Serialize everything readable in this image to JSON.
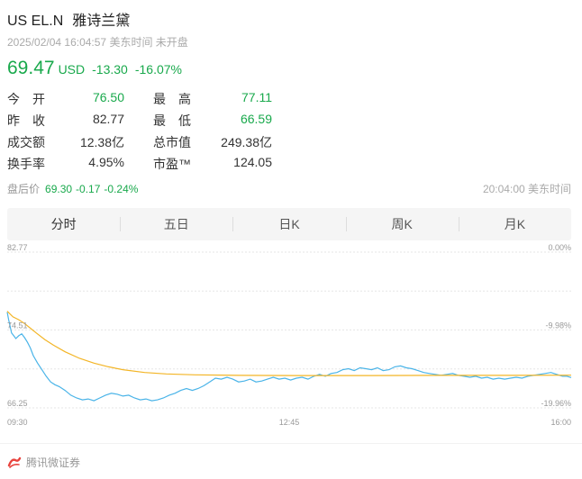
{
  "header": {
    "symbol": "US EL.N",
    "name": "雅诗兰黛",
    "timestamp": "2025/02/04 16:04:57 美东时间 未开盘"
  },
  "quote": {
    "price": "69.47",
    "currency": "USD",
    "change": "-13.30",
    "change_pct": "-16.07%",
    "color_down": "#19a94c"
  },
  "stats": [
    {
      "label": "今开",
      "value": "76.50",
      "label2": "最高",
      "value2": "77.11"
    },
    {
      "label": "昨收",
      "value": "82.77",
      "label2": "最低",
      "value2": "66.59"
    },
    {
      "label": "成交额",
      "value": "12.38亿",
      "label2": "总市值",
      "value2": "249.38亿"
    },
    {
      "label": "换手率",
      "value": "4.95%",
      "label2": "市盈™",
      "value2": "124.05"
    }
  ],
  "after_hours": {
    "label": "盘后价",
    "price": "69.30",
    "change": "-0.17",
    "change_pct": "-0.24%",
    "time": "20:04:00 美东时间"
  },
  "tabs": [
    "分时",
    "五日",
    "日K",
    "周K",
    "月K"
  ],
  "active_tab": 0,
  "chart_data": {
    "type": "line",
    "y_left_ticks": [
      "82.77",
      "74.51",
      "66.25"
    ],
    "y_right_ticks": [
      "0.00%",
      "-9.98%",
      "-19.96%"
    ],
    "x_ticks": [
      "09:30",
      "12:45",
      "16:00"
    ],
    "ylim": [
      66.25,
      82.77
    ],
    "grid": true,
    "series": [
      {
        "role": "price",
        "color": "#4ab4e8",
        "points": [
          [
            0,
            76.4
          ],
          [
            1,
            75.6
          ],
          [
            2,
            74.9
          ],
          [
            3,
            74.2
          ],
          [
            4,
            74.0
          ],
          [
            6,
            73.6
          ],
          [
            8,
            73.9
          ],
          [
            10,
            74.1
          ],
          [
            12,
            73.7
          ],
          [
            14,
            73.2
          ],
          [
            16,
            72.6
          ],
          [
            18,
            71.8
          ],
          [
            21,
            71.0
          ],
          [
            24,
            70.3
          ],
          [
            27,
            69.6
          ],
          [
            30,
            69.0
          ],
          [
            33,
            68.7
          ],
          [
            36,
            68.5
          ],
          [
            40,
            68.1
          ],
          [
            44,
            67.6
          ],
          [
            48,
            67.3
          ],
          [
            52,
            67.1
          ],
          [
            56,
            67.2
          ],
          [
            60,
            67.0
          ],
          [
            64,
            67.3
          ],
          [
            68,
            67.6
          ],
          [
            72,
            67.8
          ],
          [
            76,
            67.7
          ],
          [
            80,
            67.5
          ],
          [
            84,
            67.6
          ],
          [
            88,
            67.3
          ],
          [
            92,
            67.1
          ],
          [
            96,
            67.2
          ],
          [
            100,
            67.0
          ],
          [
            104,
            67.1
          ],
          [
            108,
            67.3
          ],
          [
            112,
            67.6
          ],
          [
            116,
            67.8
          ],
          [
            120,
            68.1
          ],
          [
            124,
            68.3
          ],
          [
            128,
            68.1
          ],
          [
            132,
            68.3
          ],
          [
            136,
            68.6
          ],
          [
            140,
            69.0
          ],
          [
            144,
            69.4
          ],
          [
            148,
            69.3
          ],
          [
            152,
            69.5
          ],
          [
            156,
            69.3
          ],
          [
            160,
            69.0
          ],
          [
            164,
            69.1
          ],
          [
            168,
            69.3
          ],
          [
            172,
            69.0
          ],
          [
            176,
            69.1
          ],
          [
            180,
            69.3
          ],
          [
            184,
            69.5
          ],
          [
            188,
            69.3
          ],
          [
            192,
            69.4
          ],
          [
            196,
            69.2
          ],
          [
            200,
            69.4
          ],
          [
            204,
            69.5
          ],
          [
            208,
            69.3
          ],
          [
            212,
            69.6
          ],
          [
            216,
            69.8
          ],
          [
            220,
            69.6
          ],
          [
            224,
            69.9
          ],
          [
            228,
            70.0
          ],
          [
            232,
            70.3
          ],
          [
            236,
            70.4
          ],
          [
            240,
            70.2
          ],
          [
            244,
            70.5
          ],
          [
            248,
            70.4
          ],
          [
            252,
            70.3
          ],
          [
            256,
            70.5
          ],
          [
            260,
            70.2
          ],
          [
            264,
            70.3
          ],
          [
            268,
            70.6
          ],
          [
            272,
            70.7
          ],
          [
            276,
            70.5
          ],
          [
            280,
            70.4
          ],
          [
            284,
            70.2
          ],
          [
            288,
            70.0
          ],
          [
            292,
            69.9
          ],
          [
            296,
            69.8
          ],
          [
            300,
            69.7
          ],
          [
            304,
            69.8
          ],
          [
            308,
            69.9
          ],
          [
            312,
            69.7
          ],
          [
            316,
            69.6
          ],
          [
            320,
            69.5
          ],
          [
            324,
            69.6
          ],
          [
            328,
            69.4
          ],
          [
            332,
            69.5
          ],
          [
            336,
            69.3
          ],
          [
            340,
            69.4
          ],
          [
            344,
            69.3
          ],
          [
            348,
            69.4
          ],
          [
            352,
            69.5
          ],
          [
            356,
            69.4
          ],
          [
            360,
            69.6
          ],
          [
            364,
            69.7
          ],
          [
            368,
            69.8
          ],
          [
            372,
            69.9
          ],
          [
            376,
            70.0
          ],
          [
            380,
            69.8
          ],
          [
            384,
            69.6
          ],
          [
            387,
            69.6
          ],
          [
            390,
            69.47
          ]
        ]
      },
      {
        "role": "average",
        "color": "#f3b526",
        "points": [
          [
            0,
            76.5
          ],
          [
            4,
            75.9
          ],
          [
            8,
            75.6
          ],
          [
            12,
            75.2
          ],
          [
            16,
            74.7
          ],
          [
            20,
            74.2
          ],
          [
            26,
            73.5
          ],
          [
            32,
            72.9
          ],
          [
            40,
            72.2
          ],
          [
            50,
            71.5
          ],
          [
            60,
            71.0
          ],
          [
            70,
            70.6
          ],
          [
            80,
            70.3
          ],
          [
            95,
            70.0
          ],
          [
            110,
            69.85
          ],
          [
            130,
            69.75
          ],
          [
            160,
            69.7
          ],
          [
            200,
            69.68
          ],
          [
            250,
            69.68
          ],
          [
            300,
            69.7
          ],
          [
            350,
            69.7
          ],
          [
            390,
            69.72
          ]
        ]
      }
    ],
    "x_total_minutes": 390
  },
  "footer": {
    "brand": "腾讯微证券"
  }
}
